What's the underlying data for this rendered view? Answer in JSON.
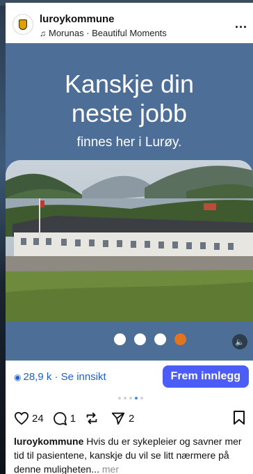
{
  "post": {
    "username": "luroykommune",
    "music_note_icon": "music-note-icon",
    "music_label": "Morunas · Beautiful Moments",
    "more_label": "..."
  },
  "media": {
    "headline_line1": "Kanskje din",
    "headline_line2": "neste jobb",
    "subline": "finnes her i Lurøy.",
    "background_color": "#4d6e97",
    "carousel": {
      "count": 4,
      "active_index": 4,
      "active_color": "#e07420"
    }
  },
  "insights": {
    "views_label": "28,9 k · Se innsikt",
    "boost_label": "Frem innlegg",
    "boost_color": "#4c5cf6"
  },
  "actions": {
    "likes": "24",
    "comments": "1",
    "shares": "2"
  },
  "caption": {
    "username": "luroykommune",
    "text": " Hvis du er sykepleier og savner mer tid til pasientene, kanskje du vil se litt nærmere på denne muligheten...",
    "more_label": " mer"
  }
}
